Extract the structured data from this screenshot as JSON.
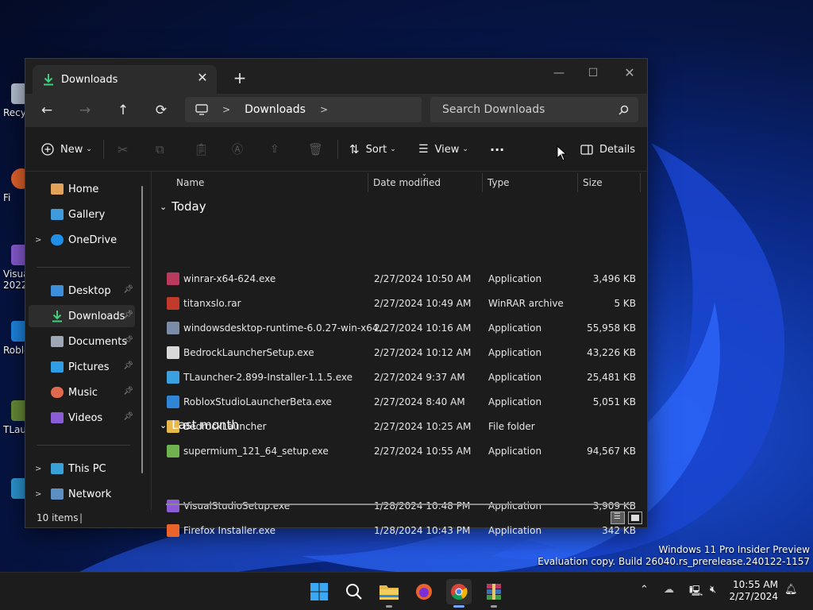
{
  "desktop": {
    "icons": [
      {
        "label": "Recy",
        "color": "#b9c4d6"
      },
      {
        "label": "Fi",
        "color": "#e8642c"
      },
      {
        "label": "Visua 2022",
        "color": "#8b5cd6"
      },
      {
        "label": "Roblo",
        "color": "#1e88e5"
      },
      {
        "label": "TLau",
        "color": "#6a8f3a"
      },
      {
        "label": "",
        "color": "#2c9ad6"
      }
    ],
    "watermark_line1": "Windows 11 Pro Insider Preview",
    "watermark_line2": "Evaluation copy. Build 26040.rs_prerelease.240122-1157"
  },
  "window": {
    "tab_title": "Downloads",
    "address": {
      "segment": "Downloads"
    },
    "search_placeholder": "Search Downloads",
    "toolbar": {
      "new_label": "New",
      "sort_label": "Sort",
      "view_label": "View",
      "more_label": "···",
      "details_label": "Details"
    },
    "sidebar": {
      "home": "Home",
      "gallery": "Gallery",
      "onedrive": "OneDrive",
      "desktop": "Desktop",
      "downloads": "Downloads",
      "documents": "Documents",
      "pictures": "Pictures",
      "music": "Music",
      "videos": "Videos",
      "thispc": "This PC",
      "network": "Network"
    },
    "columns": {
      "name": "Name",
      "date": "Date modified",
      "type": "Type",
      "size": "Size"
    },
    "groups": {
      "today": "Today",
      "last_month": "Last month"
    },
    "files": [
      {
        "name": "winrar-x64-624.exe",
        "date": "2/27/2024 10:50 AM",
        "type": "Application",
        "size": "3,496 KB",
        "color": "#b83b5e"
      },
      {
        "name": "titanxslo.rar",
        "date": "2/27/2024 10:49 AM",
        "type": "WinRAR archive",
        "size": "5 KB",
        "color": "#c0392b"
      },
      {
        "name": "windowsdesktop-runtime-6.0.27-win-x64...",
        "date": "2/27/2024 10:16 AM",
        "type": "Application",
        "size": "55,958 KB",
        "color": "#7a8ca8"
      },
      {
        "name": "BedrockLauncherSetup.exe",
        "date": "2/27/2024 10:12 AM",
        "type": "Application",
        "size": "43,226 KB",
        "color": "#d9d9d9"
      },
      {
        "name": "TLauncher-2.899-Installer-1.1.5.exe",
        "date": "2/27/2024 9:37 AM",
        "type": "Application",
        "size": "25,481 KB",
        "color": "#3aa0e0"
      },
      {
        "name": "RobloxStudioLauncherBeta.exe",
        "date": "2/27/2024 8:40 AM",
        "type": "Application",
        "size": "5,051 KB",
        "color": "#2f86d6"
      },
      {
        "name": "BedrockLauncher",
        "date": "2/27/2024 10:25 AM",
        "type": "File folder",
        "size": "",
        "color": "#e8b84a"
      },
      {
        "name": "supermium_121_64_setup.exe",
        "date": "2/27/2024 10:55 AM",
        "type": "Application",
        "size": "94,567 KB",
        "color": "#6fb24f"
      }
    ],
    "files_last_month": [
      {
        "name": "VisualStudioSetup.exe",
        "date": "1/28/2024 10:48 PM",
        "type": "Application",
        "size": "3,909 KB",
        "color": "#8b5cd6"
      },
      {
        "name": "Firefox Installer.exe",
        "date": "1/28/2024 10:43 PM",
        "type": "Application",
        "size": "342 KB",
        "color": "#e8642c"
      }
    ],
    "status": {
      "count": "10 items"
    }
  },
  "taskbar": {
    "time": "10:55 AM",
    "date": "2/27/2024"
  }
}
